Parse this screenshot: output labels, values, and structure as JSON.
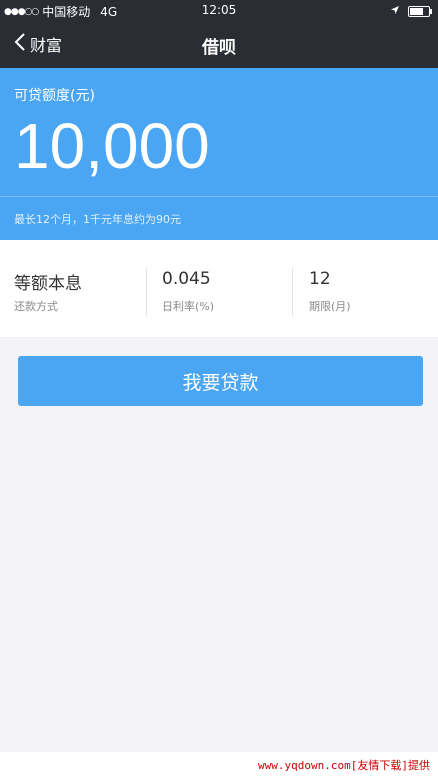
{
  "status_bar": {
    "signal": "●●●○○",
    "carrier": "中国移动",
    "network": "4G",
    "time": "12:05",
    "location_icon": "location-arrow-icon",
    "battery_level": 0.8
  },
  "nav": {
    "back_label": "财富",
    "title": "借呗"
  },
  "credit": {
    "label": "可贷额度(元)",
    "amount": "10,000",
    "note": "最长12个月，1千元年息约为90元"
  },
  "terms": [
    {
      "value": "等额本息",
      "label": "还款方式"
    },
    {
      "value": "0.045",
      "label": "日利率(%)"
    },
    {
      "value": "12",
      "label": "期限(月)"
    }
  ],
  "loan_button_label": "我要贷款",
  "watermark": "www.yqdown.com[友情下载]提供",
  "colors": {
    "nav_background": "#2a2d34",
    "accent_blue": "#4aa5f3",
    "page_background": "#f3f3f7",
    "watermark_red": "#cc0000"
  }
}
